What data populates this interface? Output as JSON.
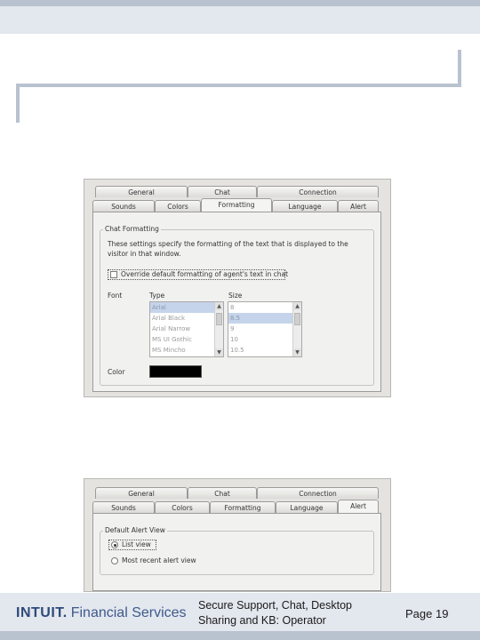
{
  "slide": {
    "footer_line1": "Secure Support, Chat, Desktop",
    "footer_line2": "Sharing and KB: Operator",
    "page_label": "Page 19",
    "logo_brand": "INTUIT.",
    "logo_rest": "Financial Services"
  },
  "dialog1": {
    "tabs_row1": [
      "General",
      "Chat",
      "Connection"
    ],
    "tabs_row2": [
      "Sounds",
      "Colors",
      "Formatting",
      "Language",
      "Alert"
    ],
    "active_tab": "Formatting",
    "group_title": "Chat Formatting",
    "description": "These settings specify the formatting of the text that is displayed to the visitor in that window.",
    "override_label": "Override default formatting of agent's text in chat",
    "override_checked": false,
    "font_label": "Font",
    "type_header": "Type",
    "size_header": "Size",
    "font_types": [
      "Arial",
      "Arial Black",
      "Arial Narrow",
      "MS UI Gothic",
      "MS Mincho"
    ],
    "font_types_selected": "Arial",
    "font_sizes": [
      "8",
      "8.5",
      "9",
      "10",
      "10.5"
    ],
    "font_sizes_selected": "8.5",
    "color_label": "Color",
    "color_value": "#000000"
  },
  "dialog2": {
    "tabs_row1": [
      "General",
      "Chat",
      "Connection"
    ],
    "tabs_row2": [
      "Sounds",
      "Colors",
      "Formatting",
      "Language",
      "Alert"
    ],
    "active_tab": "Alert",
    "group_title": "Default Alert View",
    "option_list_view": "List view",
    "option_recent_view": "Most recent alert view",
    "selected_option": "List view"
  }
}
